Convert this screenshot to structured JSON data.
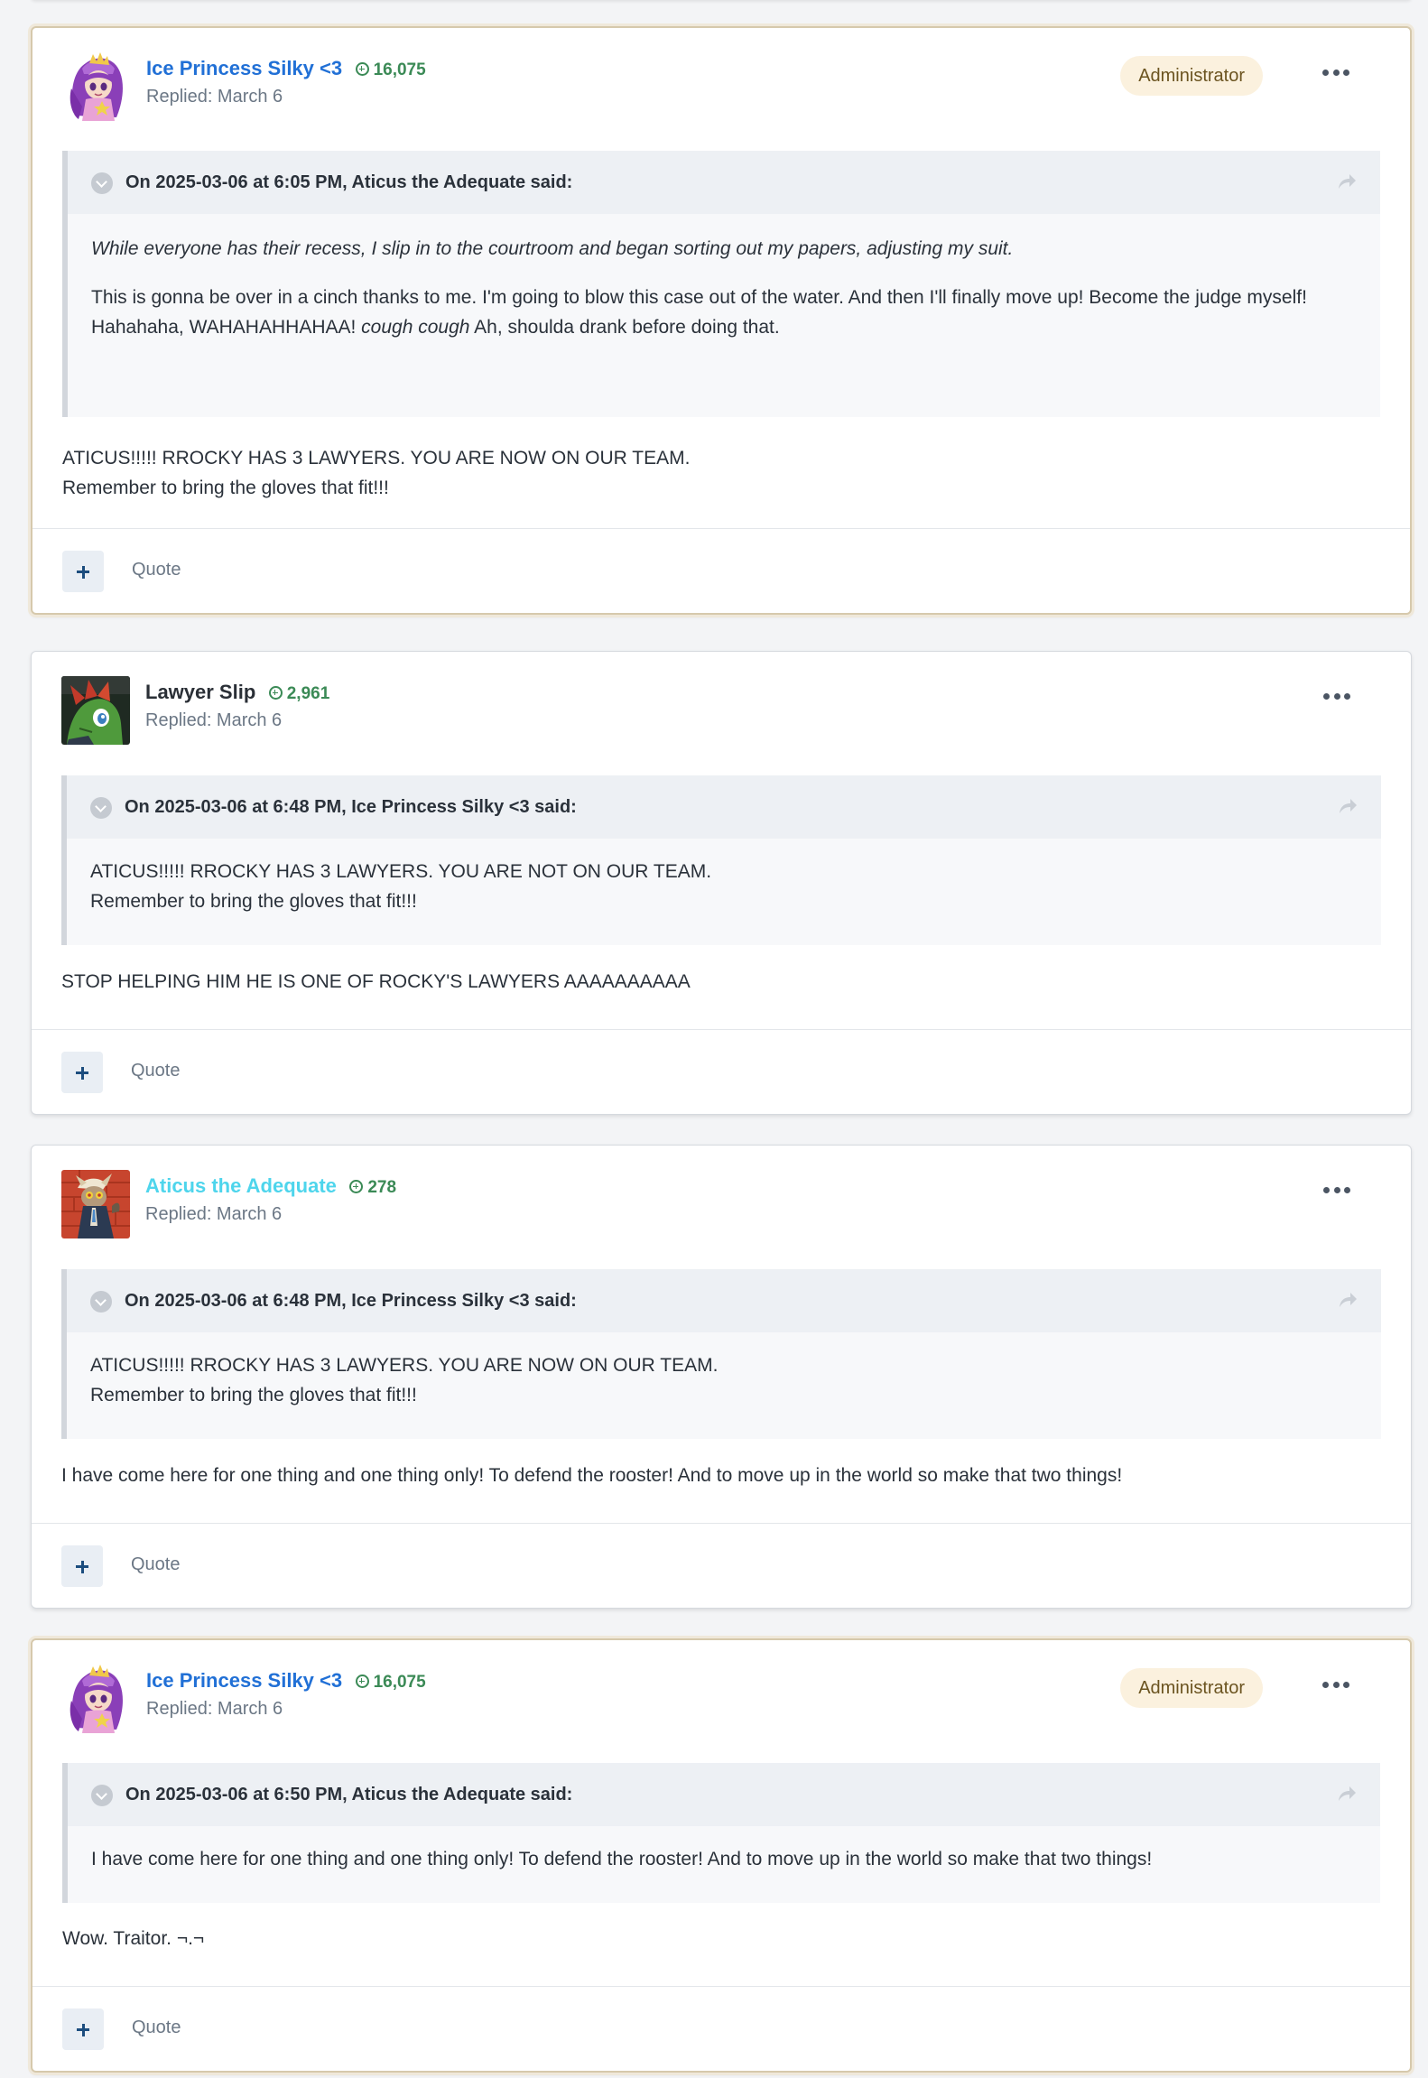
{
  "colors": {
    "admin_name": "#2170d6",
    "member_name": "#2a2f36",
    "vip_name": "#4ed5ec",
    "reputation": "#3b8a56",
    "admin_badge_bg": "#fbf1de"
  },
  "icons": {
    "reputation": "plus-circle-icon",
    "collapse": "chevron-down-circle-icon",
    "share": "share-arrow-icon",
    "more": "ellipsis-icon",
    "react": "plus-icon"
  },
  "posts": [
    {
      "author": "Ice Princess Silky <3",
      "reputation": "16,075",
      "replied": "Replied: March 6",
      "badge": "Administrator",
      "quote": {
        "citation": "On 2025-03-06 at 6:05 PM, Aticus the Adequate said:",
        "italic_line": "While everyone has their recess, I slip in to the courtroom and began sorting out my papers, adjusting my suit.",
        "text_before": "This is gonna be over in a cinch thanks to me. I'm going to blow this case out of the water. And then I'll finally move up! Become the judge myself! Hahahaha, WAHAHAHHAHAA! ",
        "text_italic": "cough cough",
        "text_after": " Ah, shoulda drank before doing that."
      },
      "body_lines": [
        "ATICUS!!!!! RROCKY HAS 3 LAWYERS. YOU ARE NOW ON OUR TEAM.",
        "Remember to bring the gloves that fit!!!"
      ],
      "quote_label": "Quote"
    },
    {
      "author": "Lawyer Slip",
      "reputation": "2,961",
      "replied": "Replied: March 6",
      "quote": {
        "citation": "On 2025-03-06 at 6:48 PM, Ice Princess Silky <3 said:",
        "lines": [
          "ATICUS!!!!! RROCKY HAS 3 LAWYERS. YOU ARE NOT ON OUR TEAM.",
          "Remember to bring the gloves that fit!!!"
        ]
      },
      "body_lines": [
        "STOP HELPING HIM HE IS ONE OF ROCKY'S LAWYERS AAAAAAAAAA"
      ],
      "quote_label": "Quote"
    },
    {
      "author": "Aticus the Adequate",
      "reputation": "278",
      "replied": "Replied: March 6",
      "quote": {
        "citation": "On 2025-03-06 at 6:48 PM, Ice Princess Silky <3 said:",
        "lines": [
          "ATICUS!!!!! RROCKY HAS 3 LAWYERS. YOU ARE NOW ON OUR TEAM.",
          "Remember to bring the gloves that fit!!!"
        ]
      },
      "body_lines": [
        "I have come here for one thing and one thing only! To defend the rooster! And to move up in the world so make that two things!"
      ],
      "quote_label": "Quote"
    },
    {
      "author": "Ice Princess Silky <3",
      "reputation": "16,075",
      "replied": "Replied: March 6",
      "badge": "Administrator",
      "quote": {
        "citation": "On 2025-03-06 at 6:50 PM, Aticus the Adequate said:",
        "lines": [
          "I have come here for one thing and one thing only! To defend the rooster! And to move up in the world so make that two things!"
        ]
      },
      "body_lines": [
        "Wow. Traitor. ¬.¬"
      ],
      "quote_label": "Quote"
    }
  ]
}
